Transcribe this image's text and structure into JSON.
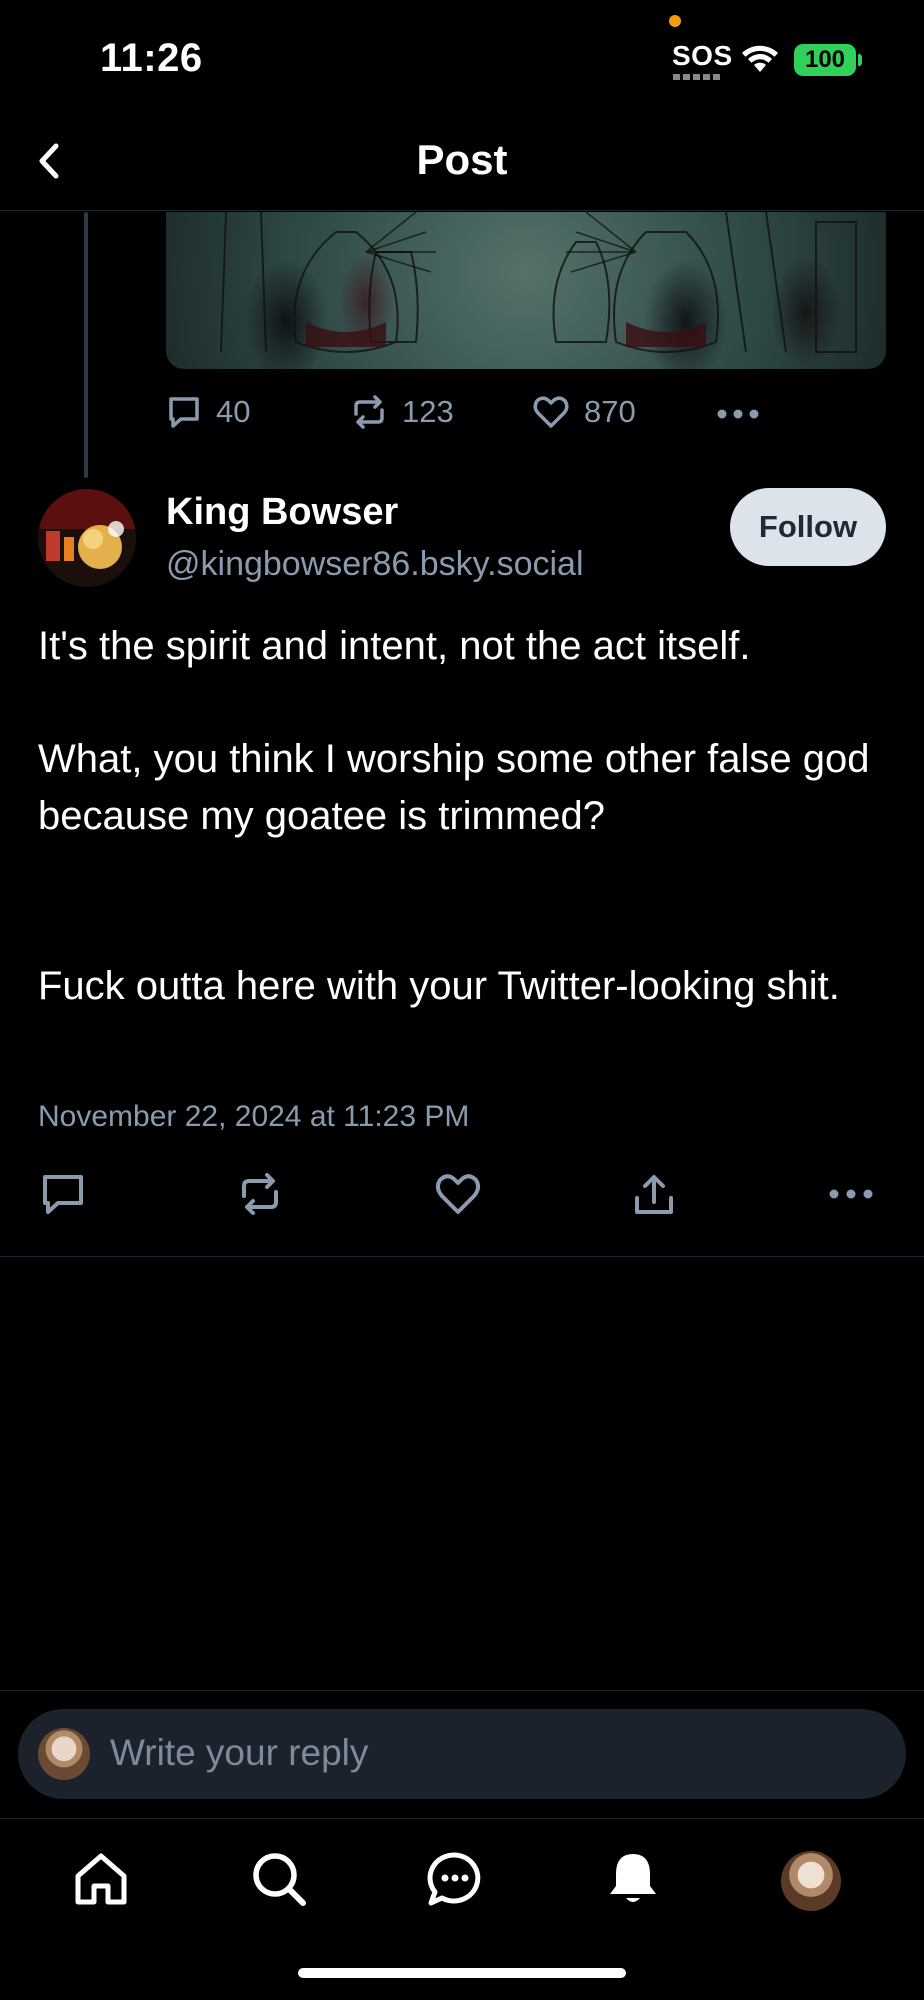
{
  "status_bar": {
    "time": "11:26",
    "sos": "SOS",
    "battery": "100",
    "colors": {
      "battery": "#30d158",
      "dot": "#f39c12"
    }
  },
  "header": {
    "title": "Post",
    "back_icon": "chevron-left-icon"
  },
  "parent_post": {
    "reply_count": "40",
    "repost_count": "123",
    "like_count": "870"
  },
  "main_post": {
    "author_name": "King Bowser",
    "author_handle": "@kingbowser86.bsky.social",
    "follow_label": "Follow",
    "paragraphs": [
      "It's the spirit and intent, not the act itself.",
      "What, you think I worship some other false god because my goatee is trimmed?",
      "Fuck outta here with your Twitter-looking shit."
    ],
    "date": "November 22, 2024 at 11:23 PM"
  },
  "reply": {
    "placeholder": "Write your reply"
  },
  "tab_bar": {
    "items": [
      "home-icon",
      "search-icon",
      "chat-icon",
      "bell-icon",
      "profile-avatar"
    ]
  },
  "theme": {
    "background": "#000000",
    "muted_text": "#8a9bb0",
    "divider": "#1e2530",
    "follow_bg": "#dde3ea"
  }
}
